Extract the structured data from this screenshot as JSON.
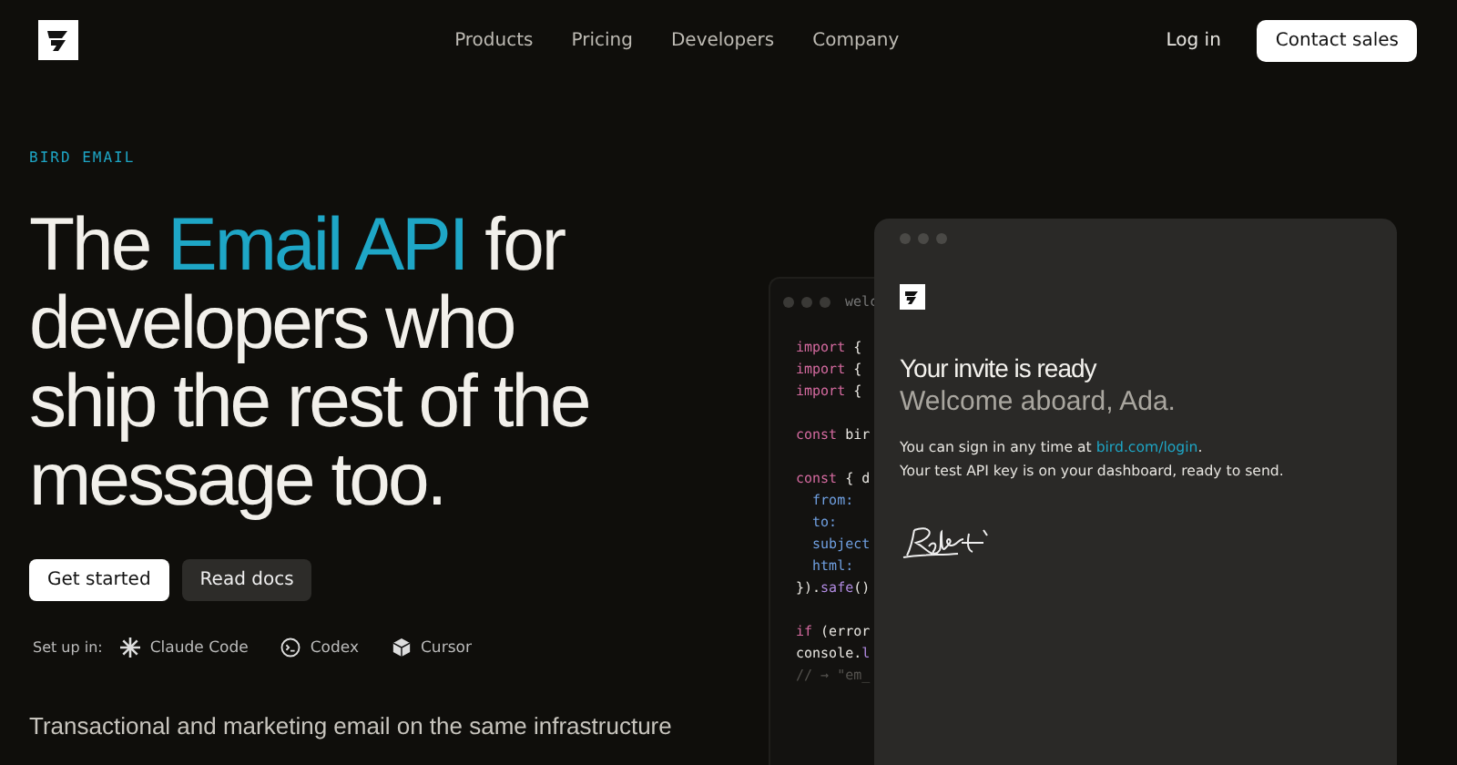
{
  "nav": {
    "links": [
      "Products",
      "Pricing",
      "Developers",
      "Company"
    ],
    "login": "Log in",
    "cta": "Contact sales"
  },
  "hero": {
    "eyebrow": "BIRD EMAIL",
    "headline": [
      "The ",
      "Email API",
      " for developers who ship the rest of the message too."
    ],
    "buttons": [
      {
        "label": "Get started",
        "kind": "primary"
      },
      {
        "label": "Read docs",
        "kind": "secondary"
      }
    ],
    "setup_label": "Set up in:",
    "tools": [
      {
        "label": "Claude Code",
        "kind": "spark"
      },
      {
        "label": "Codex",
        "kind": "terminal"
      },
      {
        "label": "Cursor",
        "kind": "cube"
      }
    ],
    "subtitle": "Transactional and marketing email on the same infrastructure"
  },
  "code_window": {
    "tab": "welc",
    "blocks": [
      {
        "lines": [
          [
            {
              "kind": "keyword",
              "text": "import"
            },
            {
              "kind": "plain",
              "text": " {"
            }
          ],
          [
            {
              "kind": "keyword",
              "text": "import"
            },
            {
              "kind": "plain",
              "text": " {"
            }
          ],
          [
            {
              "kind": "keyword",
              "text": "import"
            },
            {
              "kind": "plain",
              "text": " {"
            }
          ]
        ]
      },
      {
        "lines": [
          [
            {
              "kind": "keyword",
              "text": "const"
            },
            {
              "kind": "plain",
              "text": " bir"
            }
          ]
        ]
      },
      {
        "lines": [
          [
            {
              "kind": "keyword",
              "text": "const"
            },
            {
              "kind": "plain",
              "text": " { d"
            }
          ],
          [
            {
              "kind": "prop",
              "text": "  from:"
            }
          ],
          [
            {
              "kind": "prop",
              "text": "  to:"
            }
          ],
          [
            {
              "kind": "prop",
              "text": "  subject"
            }
          ],
          [
            {
              "kind": "prop",
              "text": "  html:"
            }
          ],
          [
            {
              "kind": "plain",
              "text": "})."
            },
            {
              "kind": "method",
              "text": "safe"
            },
            {
              "kind": "plain",
              "text": "()"
            }
          ]
        ]
      },
      {
        "lines": [
          [
            {
              "kind": "keyword",
              "text": "if"
            },
            {
              "kind": "plain",
              "text": " (error"
            }
          ],
          [
            {
              "kind": "plain",
              "text": "console."
            },
            {
              "kind": "method",
              "text": "l"
            }
          ],
          [
            {
              "kind": "comment",
              "text": "// → \"em_"
            }
          ]
        ]
      }
    ]
  },
  "email": {
    "title": "Your invite is ready",
    "greeting": "Welcome aboard, Ada.",
    "line1": "You can sign in any time at ",
    "link": "bird.com/login",
    "line1_end": ".",
    "line2": "Your test API key is on your dashboard, ready to send."
  }
}
